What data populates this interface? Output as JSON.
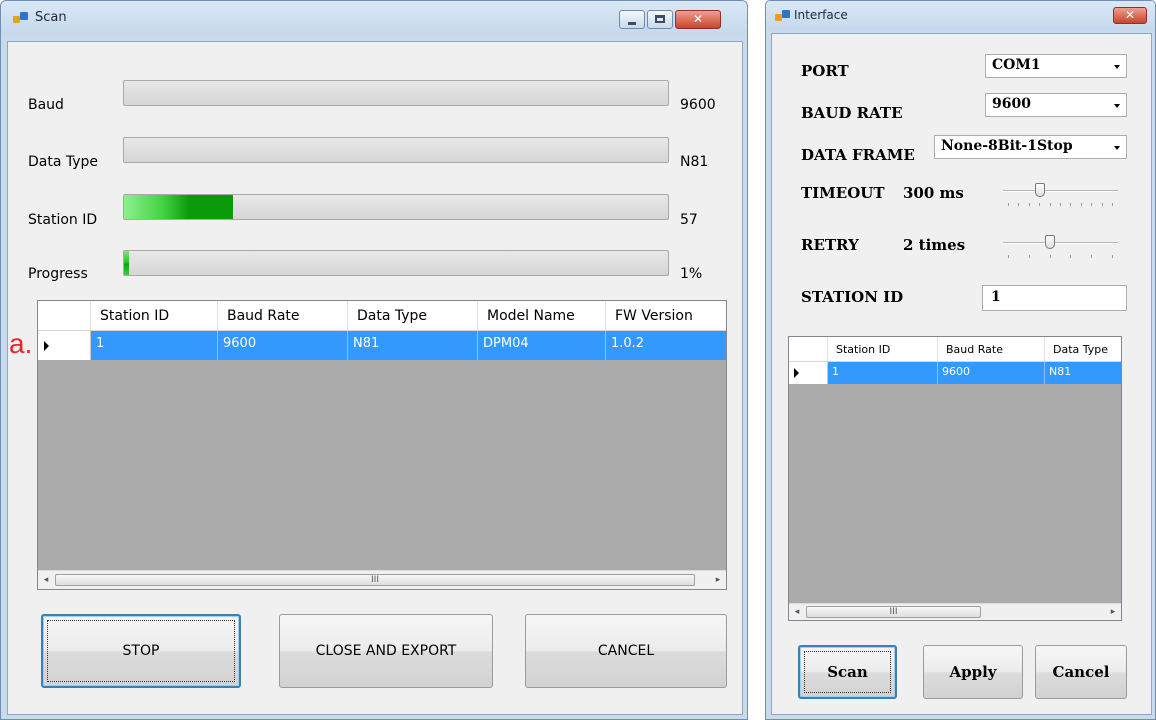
{
  "scan_window": {
    "title": "Scan",
    "progress_rows": [
      {
        "label": "Baud",
        "value": "9600",
        "fill": 0
      },
      {
        "label": "Data Type",
        "value": "N81",
        "fill": 0
      },
      {
        "label": "Station ID",
        "value": "57",
        "fill": 0.2
      },
      {
        "label": "Progress",
        "value": "1%",
        "fill": 0.01
      }
    ],
    "table": {
      "columns": [
        "Station ID",
        "Baud Rate",
        "Data Type",
        "Model Name",
        "FW Version"
      ],
      "rows": [
        {
          "selected": true,
          "cells": [
            "1",
            "9600",
            "N81",
            "DPM04",
            "1.0.2"
          ]
        }
      ]
    },
    "annotation": "a.",
    "buttons": {
      "stop": "STOP",
      "close_export": "CLOSE AND EXPORT",
      "cancel": "CANCEL"
    },
    "scroll_thumb": "III"
  },
  "interface_window": {
    "title": "Interface",
    "port": {
      "label": "PORT",
      "value": "COM1"
    },
    "baud_rate": {
      "label": "BAUD RATE",
      "value": "9600"
    },
    "data_frame": {
      "label": "DATA FRAME",
      "value": "None-8Bit-1Stop"
    },
    "timeout": {
      "label": "TIMEOUT",
      "value": "300 ms",
      "level": 0.3
    },
    "retry": {
      "label": "RETRY",
      "value": "2 times",
      "level": 0.4
    },
    "station_id": {
      "label": "STATION ID",
      "value": "1"
    },
    "table": {
      "columns": [
        "Station ID",
        "Baud Rate",
        "Data Type"
      ],
      "rows": [
        {
          "selected": true,
          "cells": [
            "1",
            "9600",
            "N81"
          ]
        }
      ]
    },
    "buttons": {
      "scan": "Scan",
      "apply": "Apply",
      "cancel": "Cancel"
    },
    "scroll_thumb": "III"
  },
  "colors": {
    "selection": "#3399ff",
    "progress_green": "#0fa30f",
    "close_red": "#c9442c",
    "annotation_red": "#e8262a"
  }
}
